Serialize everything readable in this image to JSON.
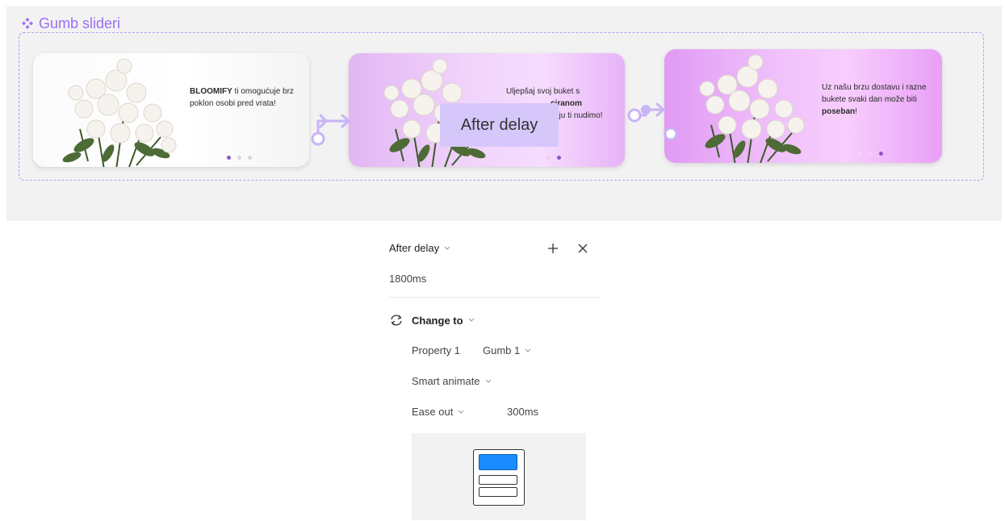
{
  "canvas": {
    "component_title": "Gumb slideri",
    "cards": [
      {
        "text_bold_lead": "BLOOMIFY",
        "text_rest": " ti omogućuje brz poklon osobi pred vrata!",
        "active_dot": 0
      },
      {
        "text_line1": "Uljepšaj svoj buket s",
        "text_bold_fragment": "ciranom",
        "text_line3": "koju ti nudimo!",
        "active_dot": 1
      },
      {
        "text_plain": "Uz našu brzu dostavu i razne bukete svaki dan može biti ",
        "text_bold_tail": "poseban",
        "text_end": "!",
        "active_dot": 2
      }
    ],
    "connector_label": "After delay"
  },
  "panel": {
    "trigger": "After delay",
    "delay": "1800ms",
    "action": "Change to",
    "property_label": "Property 1",
    "property_value": "Gumb 1",
    "animation": "Smart animate",
    "easing": "Ease out",
    "duration": "300ms"
  },
  "colors": {
    "accent_purple": "#9b6ef3",
    "frame_dash": "#b89cf5",
    "delay_label_bg": "#d6c7fb",
    "preview_blue": "#1a8cff"
  }
}
